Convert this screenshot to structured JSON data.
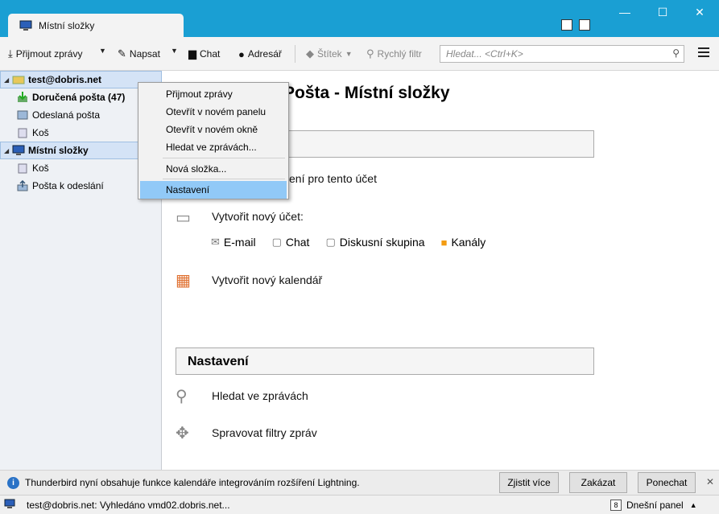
{
  "window": {
    "tab_title": "Místní složky",
    "controls": {
      "minimize": "—",
      "maximize": "☐",
      "close": "✕"
    }
  },
  "toolbar": {
    "get_mail": "Přijmout zprávy",
    "write": "Napsat",
    "chat": "Chat",
    "address_book": "Adresář",
    "tag": "Štítek",
    "quick_filter": "Rychlý filtr",
    "search_placeholder": "Hledat... <Ctrl+K>"
  },
  "folders": {
    "account": "test@dobris.net",
    "inbox": "Doručená pošta (47)",
    "sent": "Odeslaná pošta",
    "trash": "Koš",
    "local": "Místní složky",
    "local_trash": "Koš",
    "outbox": "Pošta k odeslání"
  },
  "main": {
    "heading": "Pošta - Místní složky",
    "view_settings": "vení pro tento účet",
    "create_account": "Vytvořit nový účet:",
    "links": {
      "email": "E-mail",
      "chat": "Chat",
      "newsgroup": "Diskusní skupina",
      "feeds": "Kanály"
    },
    "create_calendar": "Vytvořit nový kalendář",
    "settings_header": "Nastavení",
    "search_messages": "Hledat ve zprávách",
    "manage_filters": "Spravovat filtry zpráv"
  },
  "context_menu": {
    "items": [
      "Přijmout zprávy",
      "Otevřít v novém panelu",
      "Otevřít v novém okně",
      "Hledat ve zprávách...",
      "Nová složka...",
      "Nastavení"
    ]
  },
  "notification": {
    "text": "Thunderbird nyní obsahuje funkce kalendáře integrováním rozšíření Lightning.",
    "learn_more": "Zjistit více",
    "disable": "Zakázat",
    "keep": "Ponechat"
  },
  "statusbar": {
    "text": "test@dobris.net: Vyhledáno vmd02.dobris.net...",
    "today_pane": "Dnešní panel",
    "calendar_day": "8"
  }
}
